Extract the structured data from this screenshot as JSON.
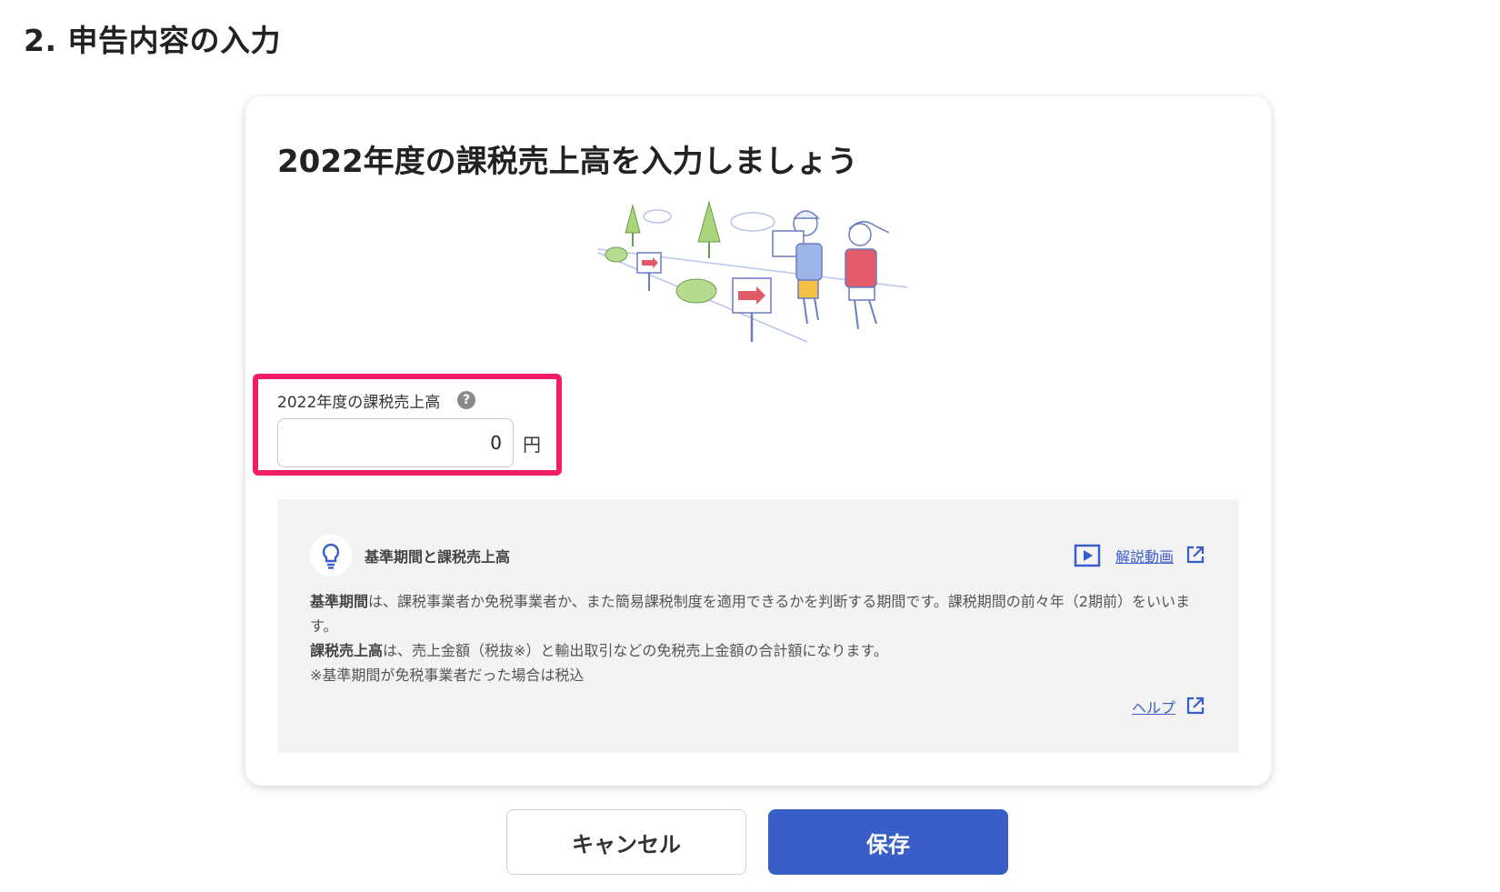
{
  "page": {
    "section_title": "2. 申告内容の入力"
  },
  "card": {
    "title": "2022年度の課税売上高を入力しましょう",
    "illustration_icon": "hikers-illustration",
    "field": {
      "label": "2022年度の課税売上高",
      "help_icon": "question-circle-icon",
      "help_glyph": "?",
      "value": "0",
      "unit": "円"
    },
    "info": {
      "icon": "lightbulb-icon",
      "title": "基準期間と課税売上高",
      "video_link": "解説動画",
      "video_icon": "play-video-icon",
      "body_1_term": "基準期間",
      "body_1_text": "は、課税事業者か免税事業者か、また簡易課税制度を適用できるかを判断する期間です。課税期間の前々年（2期前）をいいます。",
      "body_2_term": "課税売上高",
      "body_2_text": "は、売上金額（税抜※）と輸出取引などの免税売上金額の合計額になります。",
      "body_3_text": "※基準期間が免税事業者だった場合は税込",
      "help_link": "ヘルプ"
    }
  },
  "buttons": {
    "cancel": "キャンセル",
    "save": "保存"
  },
  "colors": {
    "primary": "#3a5ec8",
    "highlight": "#f21c69",
    "link": "#3b5bc8",
    "panel_bg": "#f4f3f3"
  }
}
